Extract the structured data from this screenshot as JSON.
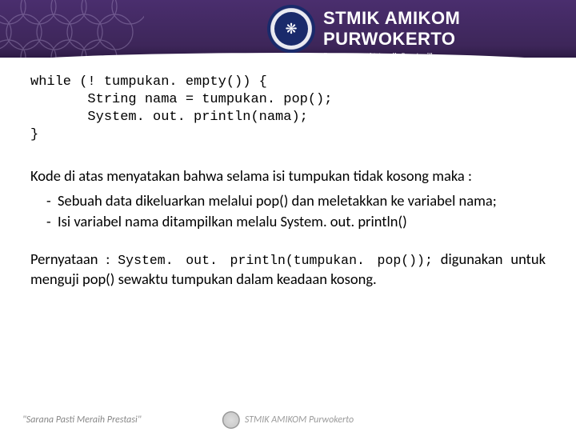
{
  "header": {
    "brand_name": "STMIK AMIKOM PURWOKERTO",
    "tagline": "\"Sarana Pasti Meraih Prestasi\""
  },
  "code": {
    "line1": "while (! tumpukan. empty()) {",
    "line2": "       String nama = tumpukan. pop();",
    "line3": "       System. out. println(nama);",
    "line4": "}"
  },
  "body": {
    "para1": "Kode di atas menyatakan bahwa selama isi tumpukan tidak kosong maka :",
    "bullet1": "Sebuah data dikeluarkan melalui pop() dan meletakkan ke variabel nama;",
    "bullet2": "Isi variabel nama ditampilkan melalu System. out. println()",
    "para2_pre": "Pernyataan : ",
    "para2_code": "System. out. println(tumpukan. pop());",
    "para2_post": " digunakan untuk menguji pop() sewaktu tumpukan dalam keadaan kosong."
  },
  "footer": {
    "left": "\"Sarana Pasti Meraih Prestasi\"",
    "mid": "STMIK AMIKOM Purwokerto"
  }
}
